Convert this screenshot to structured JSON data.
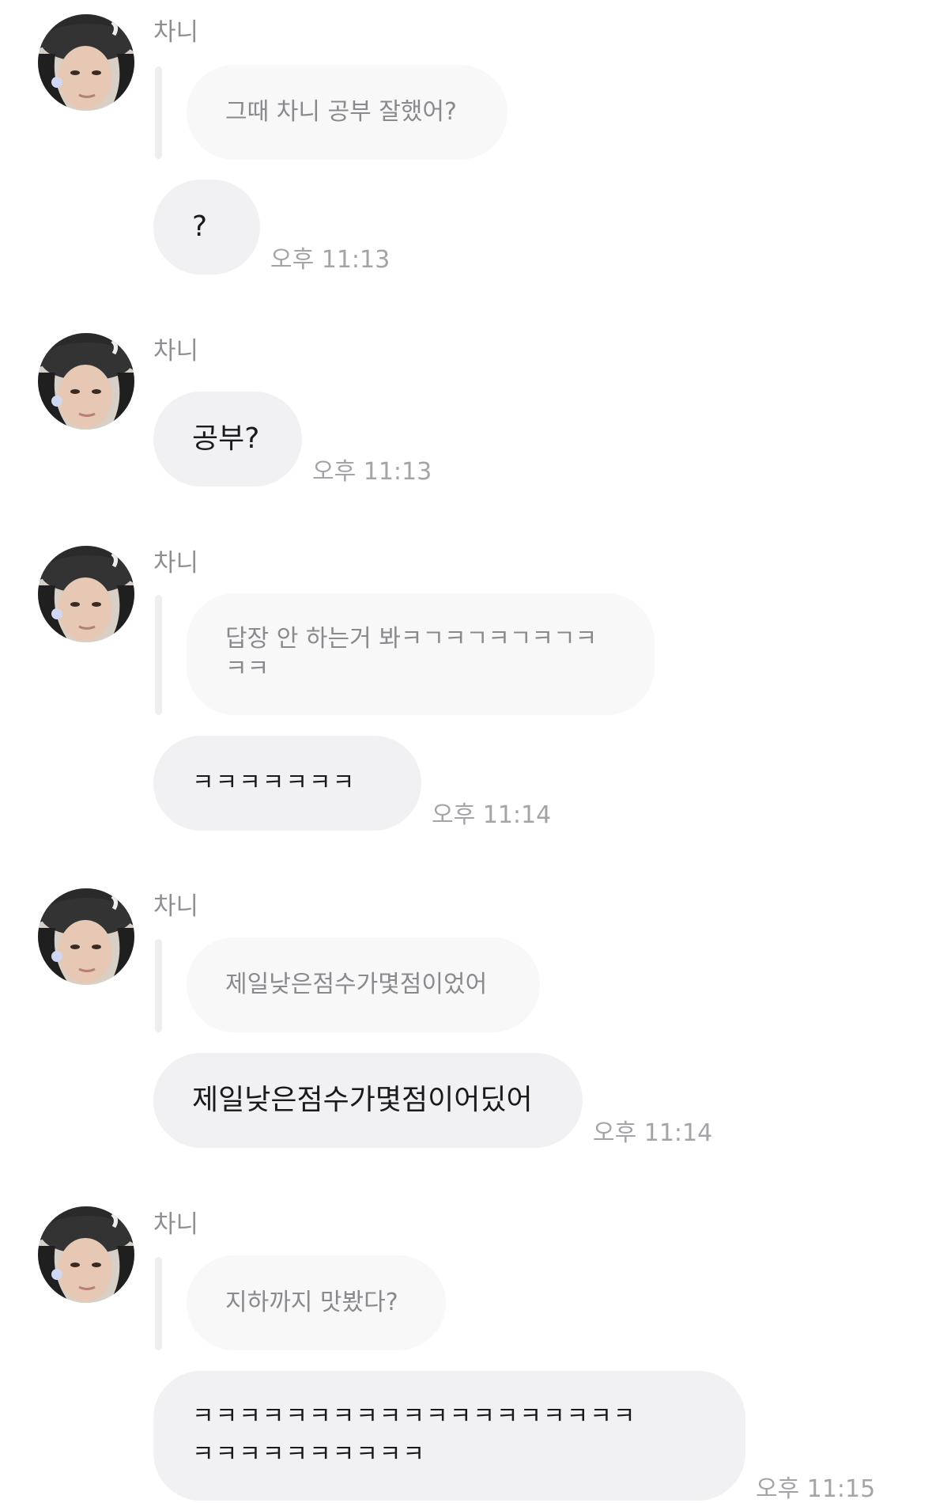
{
  "messages": [
    {
      "sender": "차니",
      "quoted": "그때 차니 공부 잘했어?",
      "reply": "?",
      "time": "오후 11:13"
    },
    {
      "sender": "차니",
      "reply": "공부?",
      "time": "오후 11:13"
    },
    {
      "sender": "차니",
      "quoted": "답장 안 하는거 봐ㅋㄱㅋㄱㅋㄱㅋㄱㅋ\nㅋㅋ",
      "reply": "ㅋㅋㅋㅋㅋㅋㅋ",
      "time": "오후 11:14"
    },
    {
      "sender": "차니",
      "quoted": "제일낮은점수가몇점이었어",
      "reply": "제일낮은점수가몇점이어딨어",
      "time": "오후 11:14"
    },
    {
      "sender": "차니",
      "quoted": "지하까지 맛봤다?",
      "reply": "ㅋㅋㅋㅋㅋㅋㅋㅋㅋㅋㅋㅋㅋㅋㅋㅋㅋㅋㅋ\nㅋㅋㅋㅋㅋㅋㅋㅋㅋㅋ",
      "time": "오후 11:15"
    }
  ]
}
